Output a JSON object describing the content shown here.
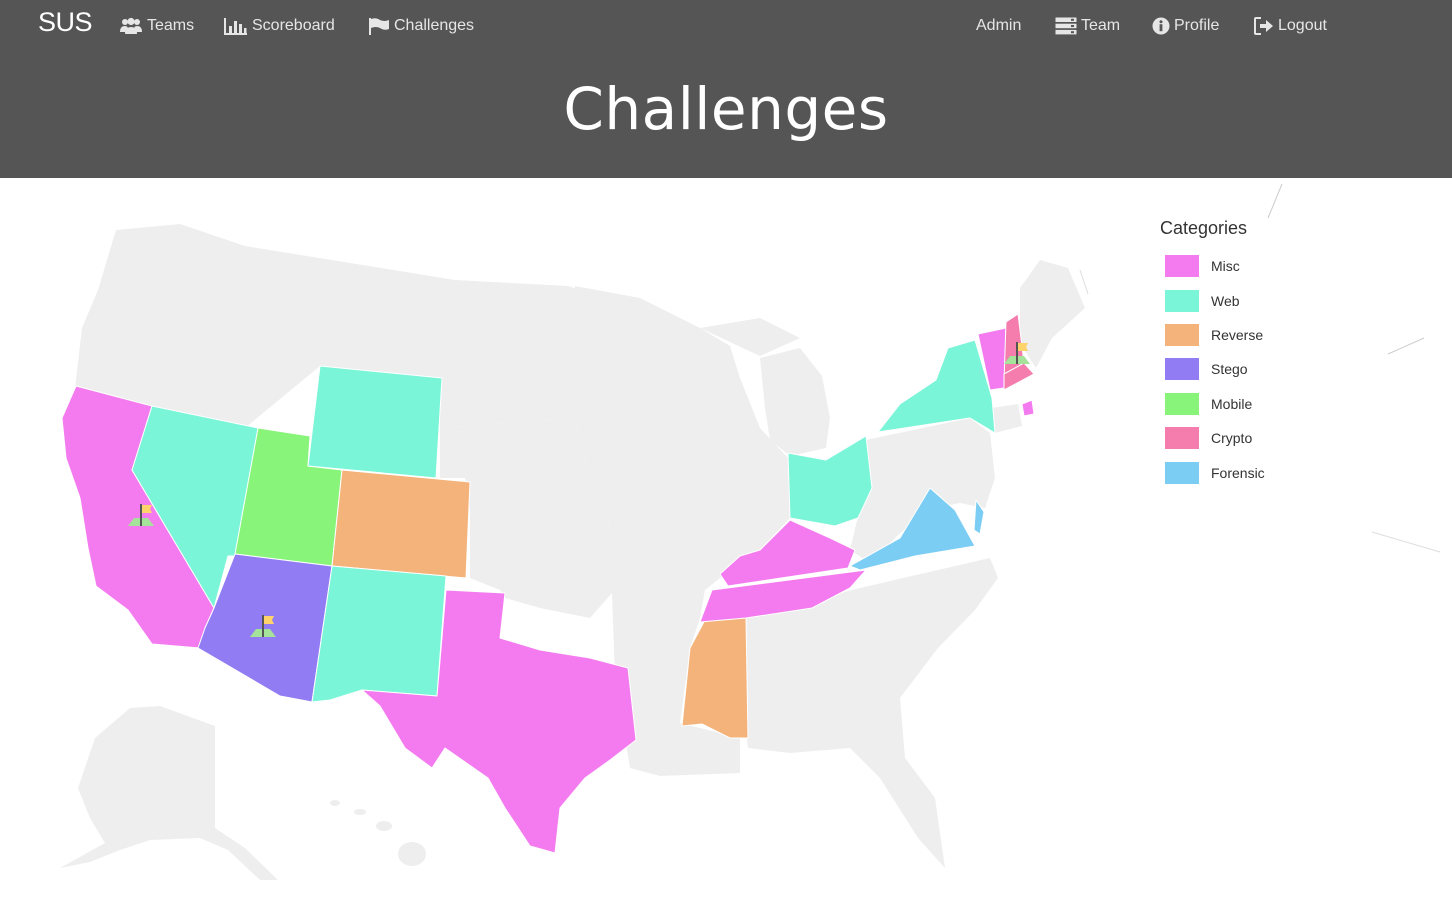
{
  "nav": {
    "brand": "SUS",
    "teams": "Teams",
    "scoreboard": "Scoreboard",
    "challenges": "Challenges",
    "admin": "Admin",
    "team": "Team",
    "profile": "Profile",
    "logout": "Logout"
  },
  "page": {
    "title": "Challenges"
  },
  "legend": {
    "title": "Categories",
    "items": [
      {
        "label": "Misc",
        "color": "#f47bef"
      },
      {
        "label": "Web",
        "color": "#7af5d8"
      },
      {
        "label": "Reverse",
        "color": "#f4b37b"
      },
      {
        "label": "Stego",
        "color": "#917cf3"
      },
      {
        "label": "Mobile",
        "color": "#88f47a"
      },
      {
        "label": "Crypto",
        "color": "#f47dad"
      },
      {
        "label": "Forensic",
        "color": "#7bcdf4"
      }
    ]
  },
  "map": {
    "default_fill": "#eeeeee",
    "states": [
      {
        "name": "California",
        "category": "Misc"
      },
      {
        "name": "Nevada",
        "category": "Web"
      },
      {
        "name": "Utah",
        "category": "Mobile"
      },
      {
        "name": "Arizona",
        "category": "Stego"
      },
      {
        "name": "Wyoming",
        "category": "Web"
      },
      {
        "name": "Colorado",
        "category": "Reverse"
      },
      {
        "name": "New Mexico",
        "category": "Web"
      },
      {
        "name": "Texas",
        "category": "Misc"
      },
      {
        "name": "Mississippi",
        "category": "Reverse"
      },
      {
        "name": "Tennessee",
        "category": "Misc"
      },
      {
        "name": "Kentucky",
        "category": "Misc"
      },
      {
        "name": "Ohio",
        "category": "Web"
      },
      {
        "name": "Virginia",
        "category": "Forensic"
      },
      {
        "name": "New York",
        "category": "Web"
      },
      {
        "name": "Vermont",
        "category": "Misc"
      },
      {
        "name": "New Hampshire",
        "category": "Crypto"
      },
      {
        "name": "Massachusetts",
        "category": "Crypto"
      },
      {
        "name": "Rhode Island",
        "category": "Misc"
      },
      {
        "name": "Delaware",
        "category": "Forensic"
      }
    ],
    "flag_markers": [
      "California",
      "Arizona",
      "New Hampshire"
    ]
  }
}
